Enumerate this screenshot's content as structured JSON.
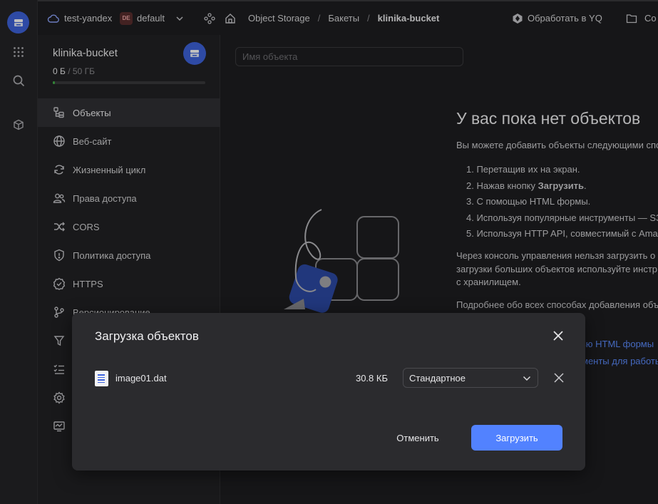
{
  "topbar": {
    "cloud": "test-yandex",
    "folder_badge": "DE",
    "folder": "default",
    "service": "Object Storage",
    "separator": "/",
    "buckets": "Бакеты",
    "bucket": "klinika-bucket",
    "process_yq": "Обработать в YQ",
    "create_partial": "Со"
  },
  "sidebar": {
    "bucket_name": "klinika-bucket",
    "usage_used": "0 Б",
    "usage_total": "/ 50 ГБ",
    "usage_fraction": 0.0,
    "items": [
      {
        "label": "Объекты",
        "icon": "objects-icon"
      },
      {
        "label": "Веб-сайт",
        "icon": "globe-icon"
      },
      {
        "label": "Жизненный цикл",
        "icon": "lifecycle-icon"
      },
      {
        "label": "Права доступа",
        "icon": "users-icon"
      },
      {
        "label": "CORS",
        "icon": "shuffle-icon"
      },
      {
        "label": "Политика доступа",
        "icon": "shield-icon"
      },
      {
        "label": "HTTPS",
        "icon": "badge-check-icon"
      },
      {
        "label": "Версионирование",
        "icon": "branch-icon"
      }
    ]
  },
  "main": {
    "search_placeholder": "Имя объекта",
    "empty_title": "У вас пока нет объектов",
    "empty_desc": "Вы можете добавить объекты следующими спо",
    "steps": [
      "1. Перетащив их на экран.",
      "2. Нажав кнопку ",
      "3. С помощью HTML формы.",
      "4. Используя популярные инструменты — S3",
      "5. Используя HTTP API, совместимый с Ama"
    ],
    "step2_bold": "Загрузить",
    "step2_end": ".",
    "note_lines": [
      "Через консоль управления нельзя загрузить о",
      "загрузки больших объектов используйте инстр",
      "с хранилищем."
    ],
    "more": "Подробнее обо всех способах добавления объ",
    "link1": "ью HTML формы",
    "link2": "менты для работы"
  },
  "dialog": {
    "title": "Загрузка объектов",
    "file": {
      "name": "image01.dat",
      "size": "30.8 КБ",
      "storage_class": "Стандартное"
    },
    "cancel": "Отменить",
    "upload": "Загрузить"
  },
  "colors": {
    "accent": "#3e63dd",
    "primary_button": "#5282ff",
    "link": "#5c8cff",
    "usage_bar": "#43b04a"
  }
}
